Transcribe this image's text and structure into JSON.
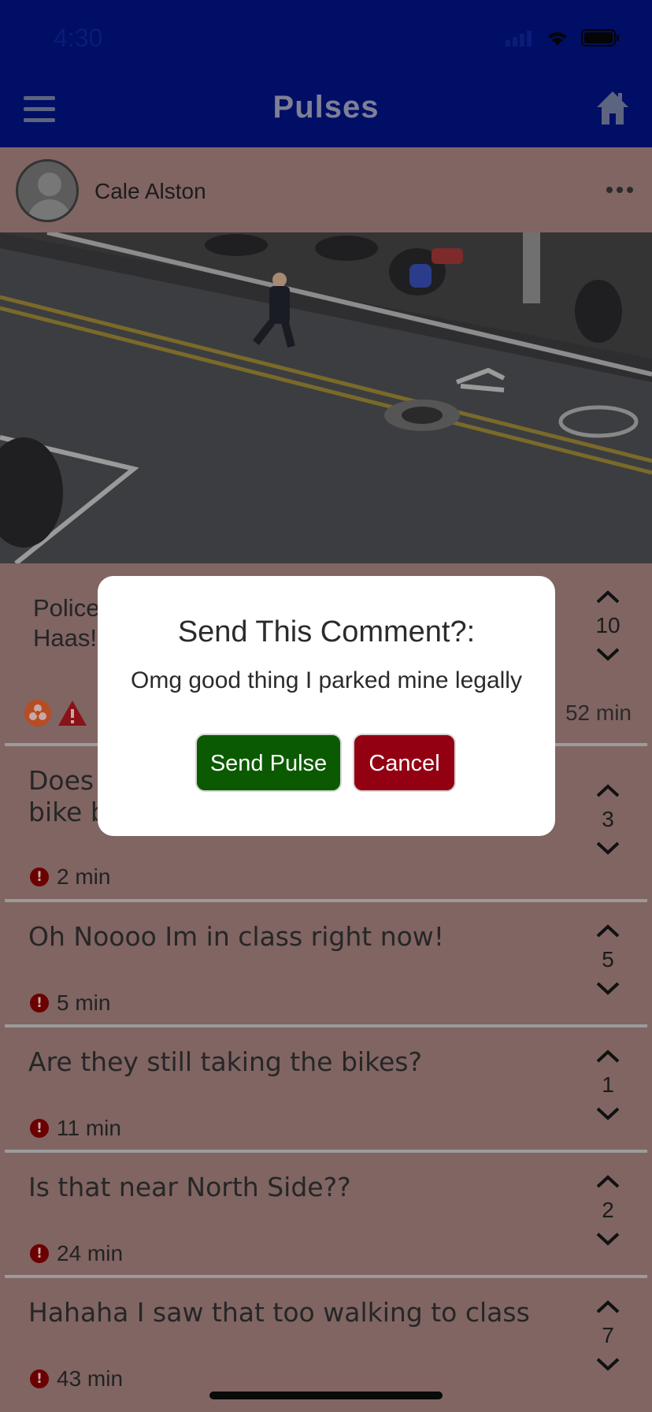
{
  "status": {
    "time": "4:30"
  },
  "nav": {
    "title": "Pulses"
  },
  "post": {
    "author": "Cale Alston",
    "text": "Police\nHaas!",
    "votes": "10",
    "time": "52 min"
  },
  "comments": [
    {
      "text": "Does\nbike b",
      "votes": "3",
      "time": "2 min"
    },
    {
      "text": "Oh Noooo Im in class right now!",
      "votes": "5",
      "time": "5 min"
    },
    {
      "text": "Are they still taking the bikes?",
      "votes": "1",
      "time": "11 min"
    },
    {
      "text": "Is that near North Side??",
      "votes": "2",
      "time": "24 min"
    },
    {
      "text": "Hahaha I saw that too walking to class",
      "votes": "7",
      "time": "43 min"
    }
  ],
  "dialog": {
    "title": "Send This Comment?:",
    "message": "Omg good thing I parked mine legally",
    "send_label": "Send Pulse",
    "cancel_label": "Cancel"
  },
  "colors": {
    "nav": "#000e66",
    "send": "#0b5a02",
    "cancel": "#930012",
    "overlay_card": "#806563"
  },
  "icons": {
    "menu": "hamburger-menu-icon",
    "home": "home-icon",
    "more": "ellipsis-icon",
    "upvote": "chevron-up-icon",
    "downvote": "chevron-down-icon",
    "alert": "exclamation-circle-icon",
    "warning": "warning-triangle-icon",
    "biohazard": "biohazard-icon"
  }
}
